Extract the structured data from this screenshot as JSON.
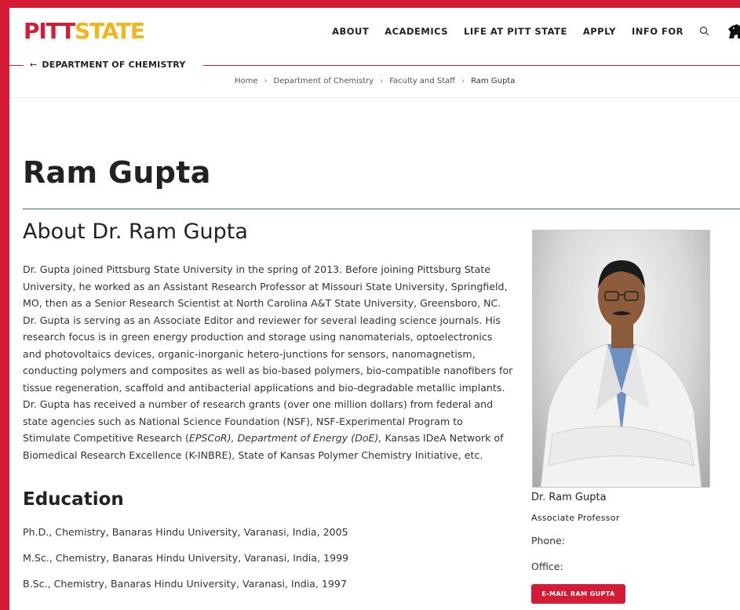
{
  "brand": {
    "logo_part1": "PITT",
    "logo_part2": "STATE",
    "primary_color": "#d41c36",
    "secondary_color": "#f2b51c"
  },
  "nav": {
    "items": [
      "ABOUT",
      "ACADEMICS",
      "LIFE AT PITT STATE",
      "APPLY",
      "INFO FOR"
    ],
    "search_icon": "search-icon",
    "mascot_icon": "gorilla-icon"
  },
  "department": {
    "back_arrow": "←",
    "label": "DEPARTMENT OF CHEMISTRY"
  },
  "breadcrumb": [
    "Home",
    "Department of Chemistry",
    "Faculty and Staff",
    "Ram Gupta"
  ],
  "page": {
    "title": "Ram Gupta"
  },
  "about": {
    "heading": "About Dr. Ram Gupta",
    "bio_part1": "Dr. Gupta joined Pittsburg State University in the spring of 2013. Before joining Pittsburg State University, he worked as an Assistant Research Professor at Missouri State University, Springfield, MO, then as a Senior Research Scientist at North Carolina A&T State University, Greensboro, NC. Dr. Gupta is serving as an Associate Editor and reviewer for several leading science journals. His research focus is in green energy production and storage using nanomaterials, optoelectronics and photovoltaics devices, organic-inorganic hetero-junctions for sensors, nanomagnetism, conducting polymers and composites as well as bio-based polymers, bio-compatible nanofibers for tissue regeneration, scaffold and antibacterial applications and bio-degradable metallic implants. Dr. Gupta has received a number of research grants (over one million dollars) from federal and state agencies such as National Science Foundation (NSF), NSF-Experimental Program to Stimulate Competitive Research (",
    "bio_italic": "EPSCoR), Department of Energy (DoE),",
    "bio_part2": " Kansas IDeA Network of Biomedical Research Excellence (K-INBRE), State of Kansas Polymer Chemistry Initiative, etc."
  },
  "education": {
    "heading": "Education",
    "items": [
      "Ph.D., Chemistry, Banaras Hindu University, Varanasi, India, 2005",
      "M.Sc., Chemistry, Banaras Hindu University, Varanasi, India, 1999",
      "B.Sc., Chemistry, Banaras Hindu University, Varanasi, India, 1997"
    ]
  },
  "profile": {
    "name": "Dr. Ram Gupta",
    "title": "Associate Professor",
    "phone_label": "Phone:",
    "office_label": "Office:",
    "email_button": "E-MAIL RAM GUPTA"
  }
}
